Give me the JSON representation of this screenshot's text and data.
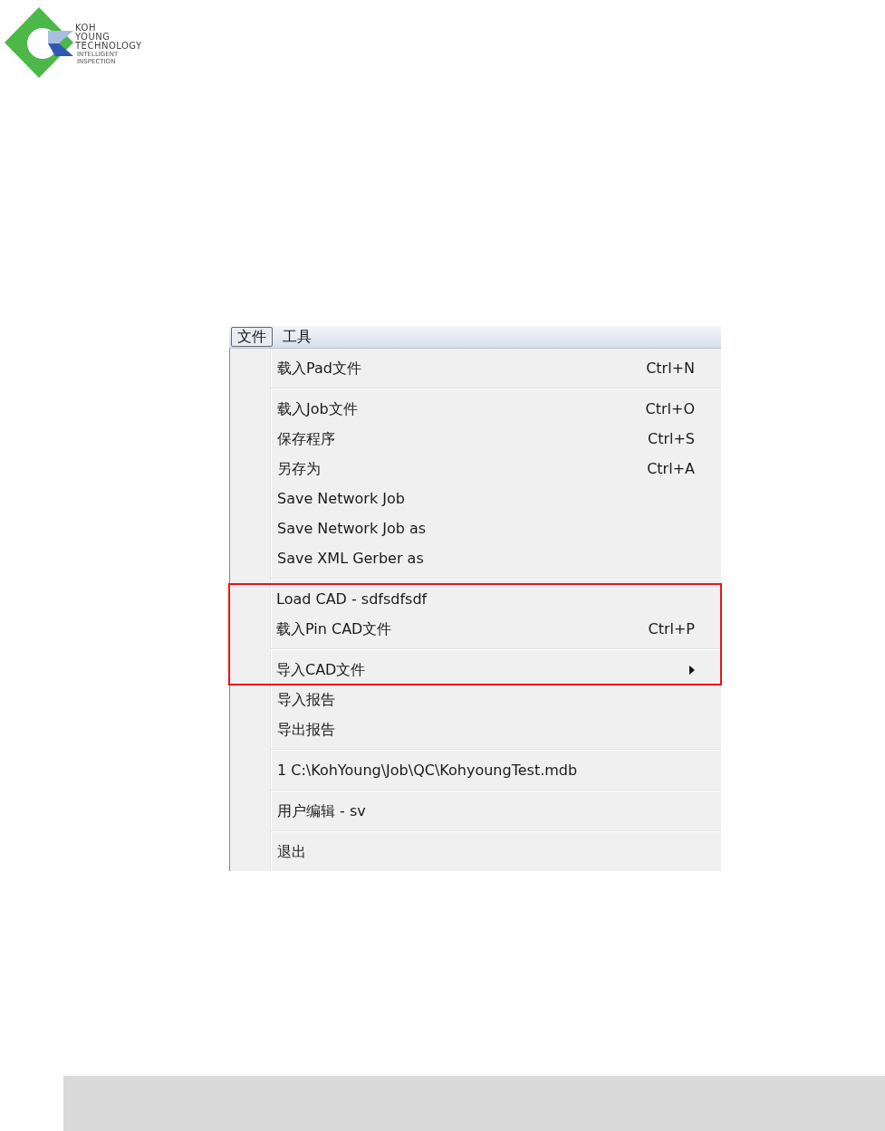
{
  "logo": {
    "lines": [
      "KOH",
      "YOUNG",
      "TECHNOLOGY"
    ],
    "tagline": [
      "INTELLIGENT",
      "INSPECTION"
    ]
  },
  "menubar": [
    {
      "label": "文件",
      "selected": true
    },
    {
      "label": "工具",
      "selected": false
    }
  ],
  "menu": {
    "groups": [
      {
        "framed": false,
        "items": [
          {
            "kind": "item",
            "label": "载入Pad文件",
            "shortcut": "Ctrl+N"
          },
          {
            "kind": "separator"
          },
          {
            "kind": "item",
            "label": "载入Job文件",
            "shortcut": "Ctrl+O"
          },
          {
            "kind": "item",
            "label": "保存程序",
            "shortcut": "Ctrl+S"
          },
          {
            "kind": "item",
            "label": "另存为",
            "shortcut": "Ctrl+A"
          },
          {
            "kind": "item",
            "label": "Save Network Job"
          },
          {
            "kind": "item",
            "label": "Save Network Job as"
          },
          {
            "kind": "item",
            "label": "Save XML Gerber as"
          },
          {
            "kind": "separator"
          }
        ]
      },
      {
        "framed": true,
        "items": [
          {
            "kind": "item",
            "label": "Load CAD - sdfsdfsdf"
          },
          {
            "kind": "item",
            "label": "载入Pin CAD文件",
            "shortcut": "Ctrl+P"
          },
          {
            "kind": "separator"
          },
          {
            "kind": "submenu",
            "label": "导入CAD文件"
          }
        ]
      },
      {
        "framed": false,
        "items": [
          {
            "kind": "item",
            "label": "导入报告"
          },
          {
            "kind": "item",
            "label": "导出报告"
          },
          {
            "kind": "separator"
          },
          {
            "kind": "item",
            "label": "1 C:\\KohYoung\\Job\\QC\\KohyoungTest.mdb"
          },
          {
            "kind": "separator"
          },
          {
            "kind": "item",
            "label": "用户编辑 - sv"
          },
          {
            "kind": "separator"
          },
          {
            "kind": "item",
            "label": "退出"
          }
        ]
      }
    ]
  }
}
